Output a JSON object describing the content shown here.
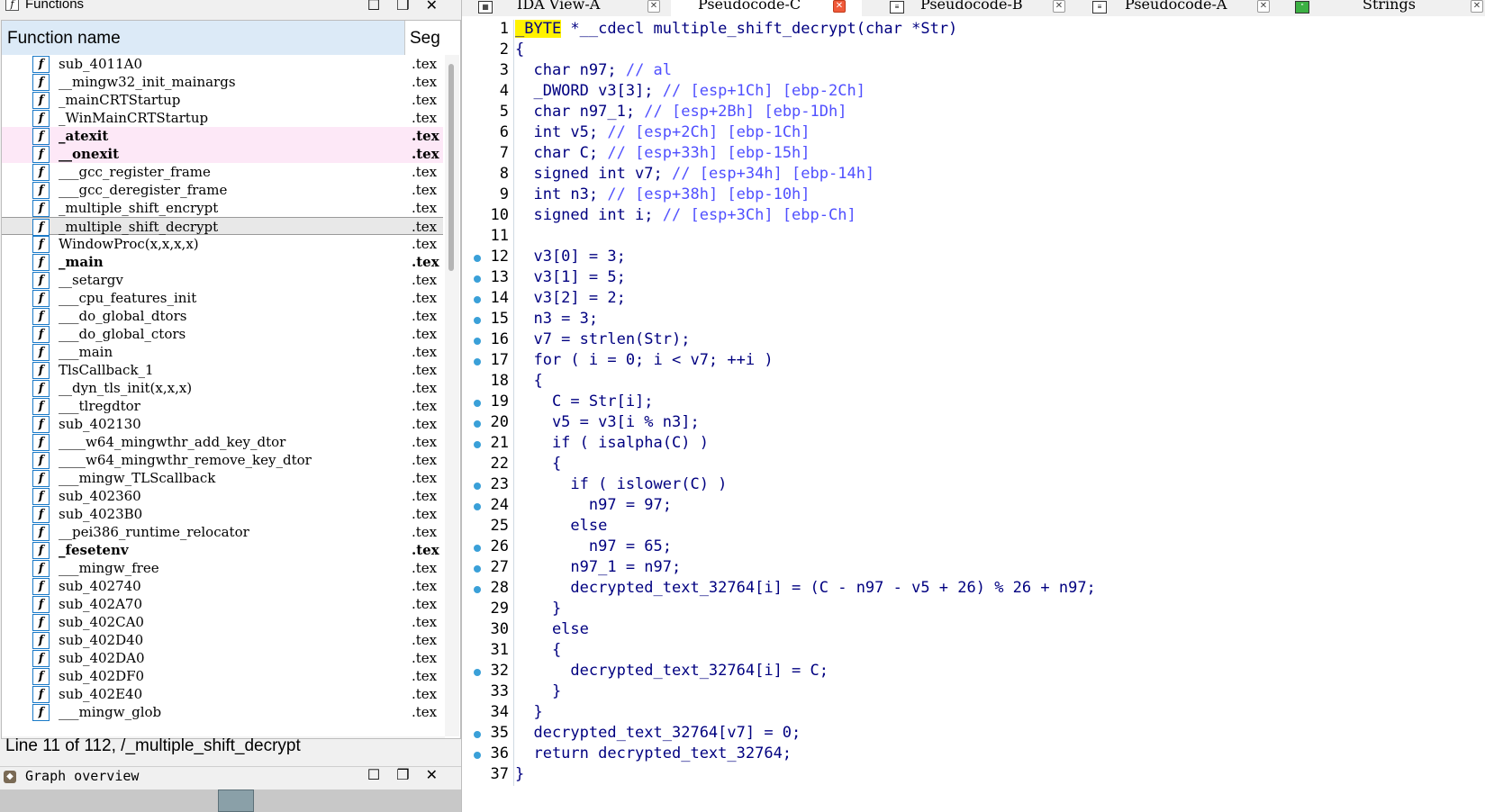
{
  "functions_window": {
    "title": "Functions",
    "header": {
      "name": "Function name",
      "segment": "Seg"
    },
    "rows": [
      {
        "name": "sub_4011A0",
        "seg": ".tex"
      },
      {
        "name": "__mingw32_init_mainargs",
        "seg": ".tex"
      },
      {
        "name": "_mainCRTStartup",
        "seg": ".tex"
      },
      {
        "name": "_WinMainCRTStartup",
        "seg": ".tex"
      },
      {
        "name": "_atexit",
        "seg": ".tex"
      },
      {
        "name": "__onexit",
        "seg": ".tex"
      },
      {
        "name": "___gcc_register_frame",
        "seg": ".tex"
      },
      {
        "name": "___gcc_deregister_frame",
        "seg": ".tex"
      },
      {
        "name": "_multiple_shift_encrypt",
        "seg": ".tex"
      },
      {
        "name": "_multiple_shift_decrypt",
        "seg": ".tex"
      },
      {
        "name": "WindowProc(x,x,x,x)",
        "seg": ".tex"
      },
      {
        "name": "_main",
        "seg": ".tex"
      },
      {
        "name": "__setargv",
        "seg": ".tex"
      },
      {
        "name": "___cpu_features_init",
        "seg": ".tex"
      },
      {
        "name": "___do_global_dtors",
        "seg": ".tex"
      },
      {
        "name": "___do_global_ctors",
        "seg": ".tex"
      },
      {
        "name": "___main",
        "seg": ".tex"
      },
      {
        "name": "TlsCallback_1",
        "seg": ".tex"
      },
      {
        "name": "__dyn_tls_init(x,x,x)",
        "seg": ".tex"
      },
      {
        "name": "___tlregdtor",
        "seg": ".tex"
      },
      {
        "name": "sub_402130",
        "seg": ".tex"
      },
      {
        "name": "____w64_mingwthr_add_key_dtor",
        "seg": ".tex"
      },
      {
        "name": "____w64_mingwthr_remove_key_dtor",
        "seg": ".tex"
      },
      {
        "name": "___mingw_TLScallback",
        "seg": ".tex"
      },
      {
        "name": "sub_402360",
        "seg": ".tex"
      },
      {
        "name": "sub_4023B0",
        "seg": ".tex"
      },
      {
        "name": "__pei386_runtime_relocator",
        "seg": ".tex"
      },
      {
        "name": "_fesetenv",
        "seg": ".tex"
      },
      {
        "name": "___mingw_free",
        "seg": ".tex"
      },
      {
        "name": "sub_402740",
        "seg": ".tex"
      },
      {
        "name": "sub_402A70",
        "seg": ".tex"
      },
      {
        "name": "sub_402CA0",
        "seg": ".tex"
      },
      {
        "name": "sub_402D40",
        "seg": ".tex"
      },
      {
        "name": "sub_402DA0",
        "seg": ".tex"
      },
      {
        "name": "sub_402DF0",
        "seg": ".tex"
      },
      {
        "name": "sub_402E40",
        "seg": ".tex"
      },
      {
        "name": "___mingw_glob",
        "seg": ".tex"
      }
    ],
    "status": "Line 11 of 112, /_multiple_shift_decrypt"
  },
  "graph_overview": {
    "title": "Graph overview"
  },
  "window_buttons": {
    "maximize": "☐",
    "restore": "❐",
    "close": "✕"
  },
  "tabs": [
    {
      "label": "IDA View-A",
      "icon": "graph-icon"
    },
    {
      "label": "Pseudocode-C",
      "icon": "code-icon"
    },
    {
      "label": "Pseudocode-B",
      "icon": "code-icon"
    },
    {
      "label": "Pseudocode-A",
      "icon": "code-icon"
    },
    {
      "label": "Strings",
      "icon": "strings-icon"
    }
  ],
  "code_lines": [
    {
      "n": "1",
      "dot": false,
      "t": "_BYTE *__cdecl multiple_shift_decrypt(char *Str)"
    },
    {
      "n": "2",
      "dot": false,
      "t": "{"
    },
    {
      "n": "3",
      "dot": false,
      "t": "  char n97; // al"
    },
    {
      "n": "4",
      "dot": false,
      "t": "  _DWORD v3[3]; // [esp+1Ch] [ebp-2Ch]"
    },
    {
      "n": "5",
      "dot": false,
      "t": "  char n97_1; // [esp+2Bh] [ebp-1Dh]"
    },
    {
      "n": "6",
      "dot": false,
      "t": "  int v5; // [esp+2Ch] [ebp-1Ch]"
    },
    {
      "n": "7",
      "dot": false,
      "t": "  char C; // [esp+33h] [ebp-15h]"
    },
    {
      "n": "8",
      "dot": false,
      "t": "  signed int v7; // [esp+34h] [ebp-14h]"
    },
    {
      "n": "9",
      "dot": false,
      "t": "  int n3; // [esp+38h] [ebp-10h]"
    },
    {
      "n": "10",
      "dot": false,
      "t": "  signed int i; // [esp+3Ch] [ebp-Ch]"
    },
    {
      "n": "11",
      "dot": false,
      "t": ""
    },
    {
      "n": "12",
      "dot": true,
      "t": "  v3[0] = 3;"
    },
    {
      "n": "13",
      "dot": true,
      "t": "  v3[1] = 5;"
    },
    {
      "n": "14",
      "dot": true,
      "t": "  v3[2] = 2;"
    },
    {
      "n": "15",
      "dot": true,
      "t": "  n3 = 3;"
    },
    {
      "n": "16",
      "dot": true,
      "t": "  v7 = strlen(Str);"
    },
    {
      "n": "17",
      "dot": true,
      "t": "  for ( i = 0; i < v7; ++i )"
    },
    {
      "n": "18",
      "dot": false,
      "t": "  {"
    },
    {
      "n": "19",
      "dot": true,
      "t": "    C = Str[i];"
    },
    {
      "n": "20",
      "dot": true,
      "t": "    v5 = v3[i % n3];"
    },
    {
      "n": "21",
      "dot": true,
      "t": "    if ( isalpha(C) )"
    },
    {
      "n": "22",
      "dot": false,
      "t": "    {"
    },
    {
      "n": "23",
      "dot": true,
      "t": "      if ( islower(C) )"
    },
    {
      "n": "24",
      "dot": true,
      "t": "        n97 = 97;"
    },
    {
      "n": "25",
      "dot": false,
      "t": "      else"
    },
    {
      "n": "26",
      "dot": true,
      "t": "        n97 = 65;"
    },
    {
      "n": "27",
      "dot": true,
      "t": "      n97_1 = n97;"
    },
    {
      "n": "28",
      "dot": true,
      "t": "      decrypted_text_32764[i] = (C - n97 - v5 + 26) % 26 + n97;"
    },
    {
      "n": "29",
      "dot": false,
      "t": "    }"
    },
    {
      "n": "30",
      "dot": false,
      "t": "    else"
    },
    {
      "n": "31",
      "dot": false,
      "t": "    {"
    },
    {
      "n": "32",
      "dot": true,
      "t": "      decrypted_text_32764[i] = C;"
    },
    {
      "n": "33",
      "dot": false,
      "t": "    }"
    },
    {
      "n": "34",
      "dot": false,
      "t": "  }"
    },
    {
      "n": "35",
      "dot": true,
      "t": "  decrypted_text_32764[v7] = 0;"
    },
    {
      "n": "36",
      "dot": true,
      "t": "  return decrypted_text_32764;"
    },
    {
      "n": "37",
      "dot": false,
      "t": "}"
    }
  ]
}
